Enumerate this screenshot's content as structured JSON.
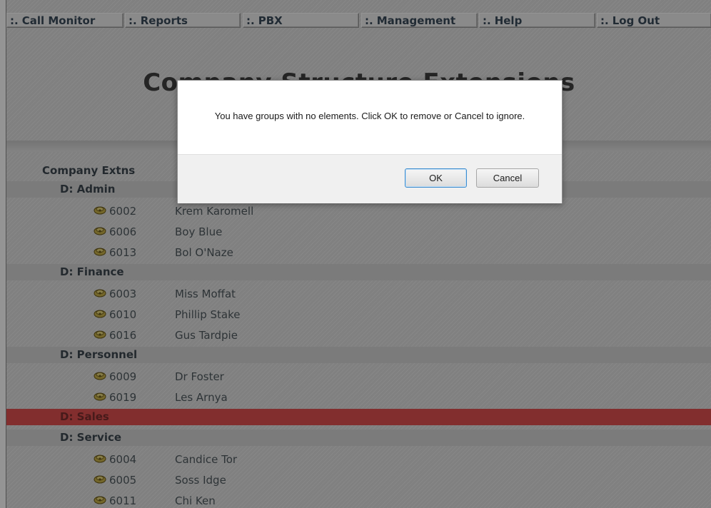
{
  "nav": {
    "items": [
      {
        "dots": ":.",
        "label": "Call Monitor"
      },
      {
        "dots": ":.",
        "label": "Reports"
      },
      {
        "dots": ":.",
        "label": "PBX"
      },
      {
        "dots": ":.",
        "label": "Management"
      },
      {
        "dots": ":.",
        "label": "Help"
      },
      {
        "dots": ":.",
        "label": "Log Out"
      }
    ]
  },
  "page": {
    "title": "Company Structure Extensions"
  },
  "tree": {
    "root_label": "Company Extns",
    "departments": [
      {
        "label": "D: Admin",
        "extensions": [
          {
            "number": "6002",
            "name": "Krem Karomell"
          },
          {
            "number": "6006",
            "name": "Boy Blue"
          },
          {
            "number": "6013",
            "name": "Bol O'Naze"
          }
        ]
      },
      {
        "label": "D: Finance",
        "extensions": [
          {
            "number": "6003",
            "name": "Miss Moffat"
          },
          {
            "number": "6010",
            "name": "Phillip Stake"
          },
          {
            "number": "6016",
            "name": "Gus Tardpie"
          }
        ]
      },
      {
        "label": "D: Personnel",
        "extensions": [
          {
            "number": "6009",
            "name": "Dr Foster"
          },
          {
            "number": "6019",
            "name": "Les Arnya"
          }
        ]
      },
      {
        "label": "D: Sales",
        "highlighted": true,
        "extensions": []
      },
      {
        "label": "D: Service",
        "extensions": [
          {
            "number": "6004",
            "name": "Candice Tor"
          },
          {
            "number": "6005",
            "name": "Soss Idge"
          },
          {
            "number": "6011",
            "name": "Chi Ken"
          }
        ]
      }
    ]
  },
  "dialog": {
    "message": "You have groups with no elements. Click OK to remove or Cancel to ignore.",
    "ok_label": "OK",
    "cancel_label": "Cancel"
  },
  "colors": {
    "highlight_row": "#e05050",
    "nav_text": "#3a4a5a",
    "ok_border": "#3c8ccf"
  },
  "icons": {
    "extension_icon": "phone-handset-icon"
  }
}
